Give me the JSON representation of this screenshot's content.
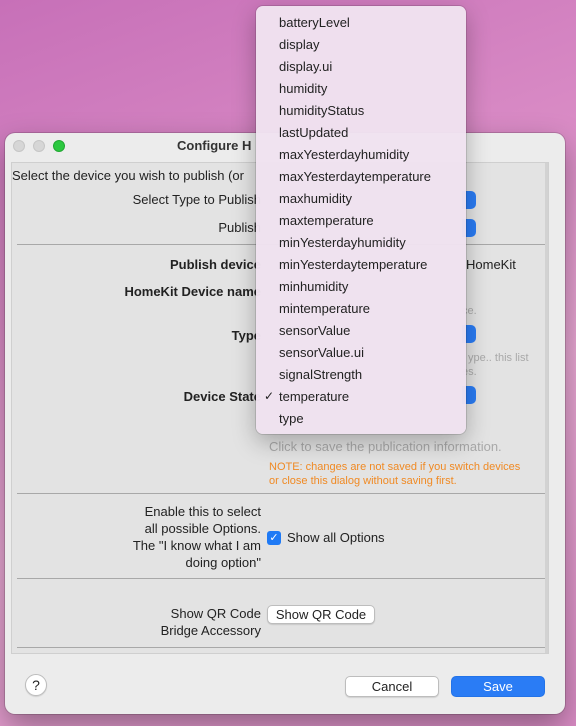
{
  "window": {
    "title": "Configure H",
    "intro": "Select the device you wish to publish (or",
    "labels": {
      "select_type": "Select Type to Publish",
      "publish": "Publish",
      "publish_device": "Publish device",
      "homekit_device_name": "HomeKit Device name",
      "type": "Type",
      "device_state": "Device State"
    },
    "right_fragments": {
      "homekit": "HomeKit",
      "ce": "ce.",
      "type_hint": "ype.. this list",
      "es": "es."
    },
    "save_hint": "Click to save the publication information.",
    "note": [
      "NOTE: changes are not saved if you switch devices",
      "or close this dialog without saving first."
    ],
    "options_label": [
      "Enable this to select",
      "all possible Options.",
      "The \"I know what I am",
      "doing option\""
    ],
    "show_all_options": {
      "label": "Show all Options",
      "checked": true
    },
    "qr_label": [
      "Show QR Code",
      "Bridge Accessory"
    ],
    "qr_button": "Show QR Code",
    "help_button": "?",
    "cancel_button": "Cancel",
    "save_button": "Save"
  },
  "dropdown": {
    "selected": "temperature",
    "items": [
      "batteryLevel",
      "display",
      "display.ui",
      "humidity",
      "humidityStatus",
      "lastUpdated",
      "maxYesterdayhumidity",
      "maxYesterdaytemperature",
      "maxhumidity",
      "maxtemperature",
      "minYesterdayhumidity",
      "minYesterdaytemperature",
      "minhumidity",
      "mintemperature",
      "sensorValue",
      "sensorValue.ui",
      "signalStrength",
      "temperature",
      "type"
    ]
  },
  "colors": {
    "accent": "#2a7cf5",
    "note": "#f08a24",
    "traffic_zoom": "#2cc840"
  }
}
